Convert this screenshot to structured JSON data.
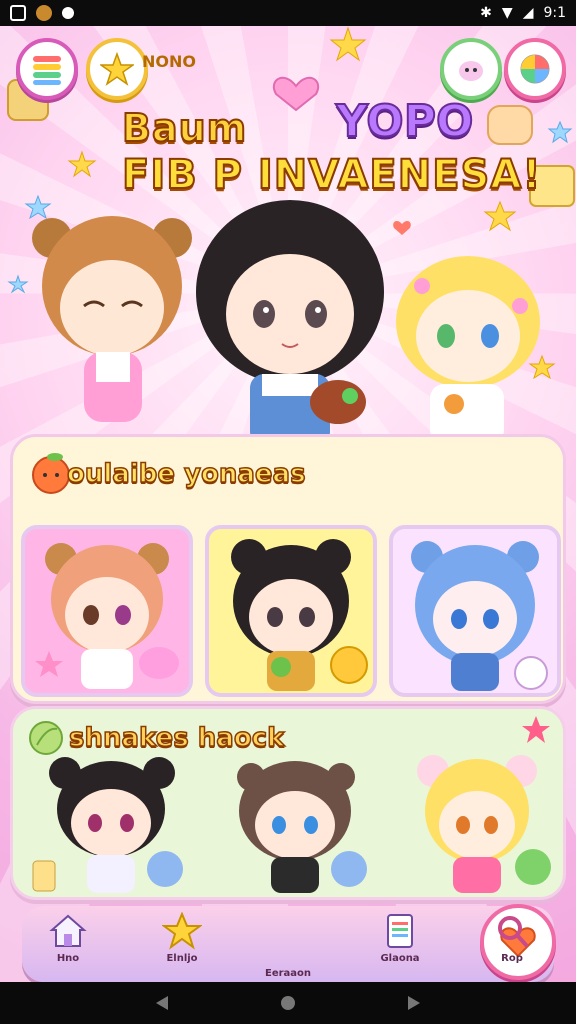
{
  "status_bar": {
    "time": "9:1",
    "left_icons": [
      "gallery-icon",
      "app-icon",
      "mail-icon"
    ],
    "right_icons": [
      "bluetooth-icon",
      "wifi-icon",
      "signal-icon"
    ]
  },
  "header": {
    "label": "NONO",
    "title_top": "Baum",
    "title_accent": "YOPO",
    "title_main": "FIB P INVAENESA!"
  },
  "sections": {
    "featured_title": "oulaibe yonaeas",
    "friends_title": "shnakes haock"
  },
  "nav": {
    "items": [
      {
        "label": "Hno",
        "icon": "house-icon"
      },
      {
        "label": "Elnljo",
        "icon": "star-icon"
      },
      {
        "label": "Eeraaon",
        "icon": "heart-icon"
      },
      {
        "label": "Glaona",
        "icon": "book-icon"
      },
      {
        "label": "Rop",
        "icon": "search-icon"
      }
    ]
  },
  "colors": {
    "accent_pink": "#f06aa6",
    "title_yellow": "#ffd23d",
    "title_purple": "#b979ff",
    "panel_cream": "#fff6d9",
    "panel_mint": "#e9f6d7"
  }
}
